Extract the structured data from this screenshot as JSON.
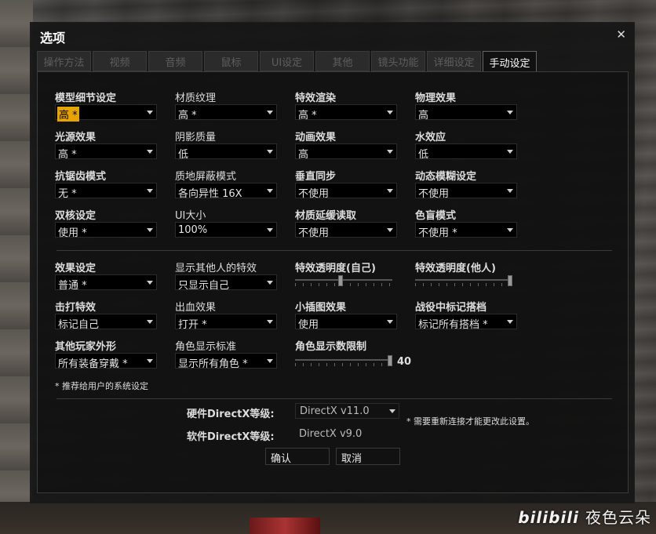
{
  "window": {
    "title": "选项",
    "close": "✕"
  },
  "tabs": [
    "操作方法",
    "视频",
    "音频",
    "鼠标",
    "UI设定",
    "其他",
    "镜头功能",
    "详细设定",
    "手动设定"
  ],
  "fields": {
    "model_detail": {
      "label": "模型细节设定",
      "value": "高 *"
    },
    "texture": {
      "label": "材质纹理",
      "value": "高 *"
    },
    "effect_render": {
      "label": "特效渲染",
      "value": "高 *"
    },
    "physics": {
      "label": "物理效果",
      "value": "高"
    },
    "light": {
      "label": "光源效果",
      "value": "高 *"
    },
    "shadow": {
      "label": "阴影质量",
      "value": "低"
    },
    "animation": {
      "label": "动画效果",
      "value": "高"
    },
    "water": {
      "label": "水效应",
      "value": "低"
    },
    "aa": {
      "label": "抗锯齿模式",
      "value": "无 *"
    },
    "aniso": {
      "label": "质地屏蔽模式",
      "value": "各向异性 16X"
    },
    "vsync": {
      "label": "垂直同步",
      "value": "不使用"
    },
    "motion_blur": {
      "label": "动态模糊设定",
      "value": "不使用"
    },
    "dual_core": {
      "label": "双核设定",
      "value": "使用 *"
    },
    "ui_size": {
      "label": "UI大小",
      "value": "100%"
    },
    "texture_delay": {
      "label": "材质延缓读取",
      "value": "不使用"
    },
    "colorblind": {
      "label": "色盲模式",
      "value": "不使用 *"
    },
    "effect_setting": {
      "label": "效果设定",
      "value": "普通 *"
    },
    "other_effects": {
      "label": "显示其他人的特效",
      "value": "只显示自己"
    },
    "hit_effect": {
      "label": "击打特效",
      "value": "标记自己"
    },
    "blood": {
      "label": "出血效果",
      "value": "打开 *"
    },
    "minimap": {
      "label": "小插图效果",
      "value": "使用"
    },
    "battle_mark": {
      "label": "战役中标记搭档",
      "value": "标记所有搭档 *"
    },
    "player_look": {
      "label": "其他玩家外形",
      "value": "所有装备穿戴 *"
    },
    "char_display": {
      "label": "角色显示标准",
      "value": "显示所有角色 *"
    }
  },
  "sliders": {
    "effect_alpha_self": {
      "label": "特效透明度(自己)",
      "level": 0.47
    },
    "effect_alpha_other": {
      "label": "特效透明度(他人)",
      "level": 1.0
    },
    "char_limit": {
      "label": "角色显示数限制",
      "level": 1.0,
      "value_text": "40"
    }
  },
  "notes": {
    "recommended": "* 推荐给用户的系统设定",
    "restart": "* 需要重新连接才能更改此设置。"
  },
  "directx": {
    "hw_label": "硬件DirectX等级:",
    "hw_value": "DirectX v11.0",
    "sw_label": "软件DirectX等级:",
    "sw_value": "DirectX v9.0"
  },
  "buttons": {
    "ok": "确认",
    "cancel": "取消"
  },
  "watermark": {
    "logo": "bilibili",
    "text": "夜色云朵"
  },
  "colors": {
    "highlight": "#e7a300",
    "active_tab_text": "#ffffff"
  }
}
